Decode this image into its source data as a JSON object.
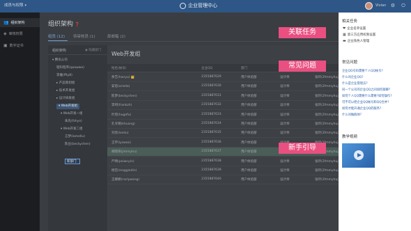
{
  "topbar": {
    "back_label": "成员与权限",
    "title": "企业管理中心",
    "user_name": "Vivian"
  },
  "sidebar": {
    "items": [
      {
        "label": "组织架构",
        "icon": "people-icon"
      },
      {
        "label": "审核权限",
        "icon": "shield-icon"
      },
      {
        "label": "数字证书",
        "icon": "certificate-icon"
      }
    ]
  },
  "main": {
    "title": "组织架构",
    "tabs": [
      {
        "label": "组员 (12)"
      },
      {
        "label": "待审核员 (1)"
      },
      {
        "label": "部邮箱 (2)"
      }
    ],
    "tree": {
      "header": "组织架构",
      "edit_label": "隐藏部门",
      "nodes": [
        "▾ 腾讯公司",
        "程科程序(qoowwe)",
        "李雅(ffty8)",
        "▸ 产品策划组",
        "▸ 技术开发组",
        "▸ 设计研发组",
        "▾ Web开发组",
        "▾ Web开发一组",
        "朱先(fzhyo)",
        "▾ Web开发二组",
        "言梦(lamellu)",
        "陈豆(beckychen)"
      ],
      "editing_value": "新部门"
    },
    "group_title": "Web开发组",
    "table": {
      "headers": [
        "姓名(帐号)",
        "企业QQ",
        "部门",
        "职务",
        "邮件"
      ],
      "rows": [
        [
          "余艺(hanyu) 👑",
          "2355887629",
          "用户体验部",
          "设计师",
          "张玲(2fmmyhuj)"
        ],
        [
          "安蓓(ariella)",
          "2355887630",
          "用户体验部",
          "设计师",
          "张玲(2fmmyhuj)"
        ],
        [
          "陈梦(beckychen)",
          "2355887631",
          "用户体验部",
          "设计师",
          "张玲(2fmmyhuj)"
        ],
        [
          "李珂(frankzh)",
          "2355887632",
          "用户体验部",
          "设计师",
          "张玲(2fmmyhuj)"
        ],
        [
          "叶瑄(hugefu)",
          "2355887633",
          "用户体验部",
          "设计师",
          "张玲(2fmmyhuj)"
        ],
        [
          "孔令璐(khuang)",
          "2355887634",
          "用户体验部",
          "设计师",
          "张玲(2fmmyhuj)"
        ],
        [
          "刘亮(leoliu)",
          "2355887635",
          "用户体验部",
          "设计师",
          "张玲(2fmmyhuj)"
        ],
        [
          "王宇(lyswoo)",
          "2355887636",
          "用户体验部",
          "设计师",
          "张玲(2fmmyhuj)"
        ],
        [
          "胡晓阳(jimmyhu)",
          "2355887637",
          "用户体验部",
          "设计师",
          "张玲(2fmmyhuj)"
        ],
        [
          "严晴(peiwnyin)",
          "2355887638",
          "用户体验部",
          "设计师",
          "张玲(2fmmyhuj)"
        ],
        [
          "杨宫(maggiedin)",
          "2355887639",
          "用户体验部",
          "设计师",
          "张玲(2fmmyhuj)"
        ],
        [
          "王娜娜(raclywang)",
          "2355887640",
          "用户体验部",
          "设计师",
          "张玲(2fmmyhuj)"
        ]
      ]
    }
  },
  "panel": {
    "tasks_title": "相关任务",
    "tasks": [
      {
        "label": "企业名单设置",
        "icon": "heart-icon"
      },
      {
        "label": "第三方应用权限设置",
        "icon": "grid-icon"
      },
      {
        "label": "企业角色人管理",
        "icon": "folder-icon"
      }
    ],
    "faq_title": "常见问题",
    "faqs": [
      "企业QQ号码需要个人QQ帐号?",
      "什么叫企业QQ?",
      "什么是企业管理员?",
      "同一个公司的企业QQ之间如何群聊?",
      "如何个人QQ需要什么需要?如何操作?",
      "可不可以把企业QQ帐号和QQ合并?",
      "如何才能开通企业QQ的服务?",
      "什么叫做群体?"
    ],
    "video_title": "教学视频"
  },
  "callouts": {
    "tasks": "关联任务",
    "faq": "常见问题",
    "guide": "新手引导"
  }
}
